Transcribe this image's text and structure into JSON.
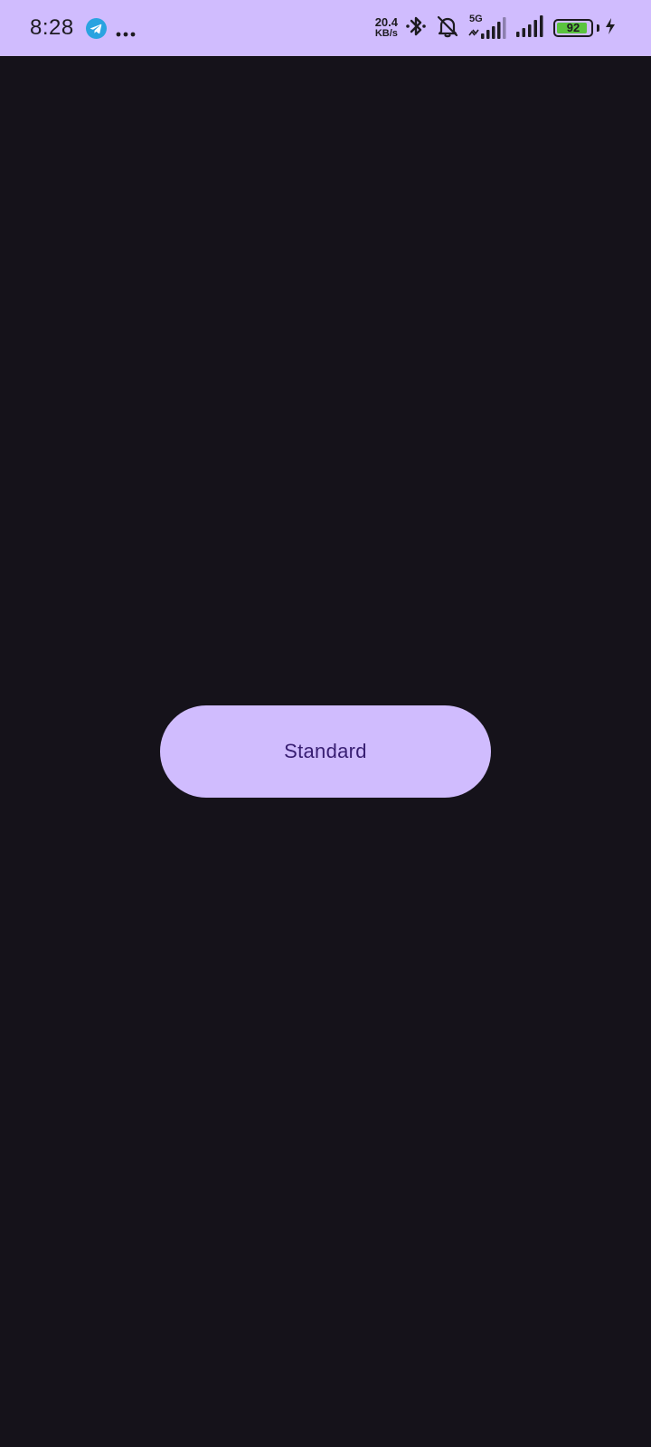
{
  "status_bar": {
    "time": "8:28",
    "net_speed_value": "20.4",
    "net_speed_unit": "KB/s",
    "network_type": "5G",
    "battery_level": "92",
    "battery_fraction": 0.92,
    "icons": [
      "telegram-icon",
      "more-icon",
      "bluetooth-icon",
      "bell-off-icon",
      "signal-5g-icon",
      "signal-icon",
      "battery-icon",
      "charging-icon"
    ],
    "colors": {
      "background": "#d0bcfe",
      "foreground": "#1d1b20",
      "telegram": "#2aa3e0",
      "battery_fill": "#5ac43e"
    }
  },
  "main": {
    "button_label": "Standard",
    "colors": {
      "background": "#15121a",
      "button": "#d0bcfe",
      "button_text": "#381e72"
    }
  }
}
